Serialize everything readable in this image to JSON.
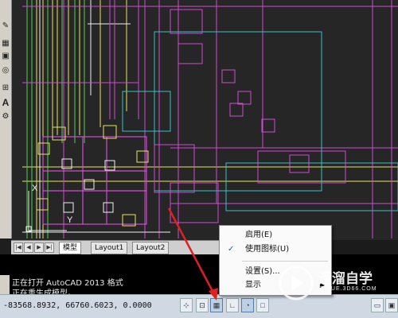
{
  "left_toolbar": {
    "icons": [
      "pen-icon",
      "hatch-icon",
      "region-icon",
      "table-icon",
      "text-icon",
      "insert-icon"
    ],
    "text_label": "A"
  },
  "layout_tabs": {
    "tabs": [
      {
        "label": "模型"
      },
      {
        "label": "Layout1"
      },
      {
        "label": "Layout2"
      }
    ]
  },
  "command_line": {
    "lines": [
      "正在打开 AutoCAD 2013 格式",
      "正在重生成模型。"
    ]
  },
  "status_bar": {
    "coordinates": "-83568.8932, 66760.6023, 0.0000"
  },
  "context_menu": {
    "items": [
      {
        "label": "启用(E)",
        "checked": false
      },
      {
        "label": "使用图标(U)",
        "checked": true
      },
      {
        "label": "设置(S)...",
        "checked": false
      },
      {
        "label": "显示",
        "checked": false
      }
    ]
  },
  "watermark": {
    "brand": "溜溜自学",
    "site": "ZIXUE.3D66.COM"
  },
  "colors": {
    "magenta": "#d24bd2",
    "yellow": "#e6e65a",
    "cyan": "#35c3c8",
    "white": "#f0f0f0",
    "green": "#4fd24f",
    "red_arrow": "#e02020",
    "background": "#262626"
  }
}
